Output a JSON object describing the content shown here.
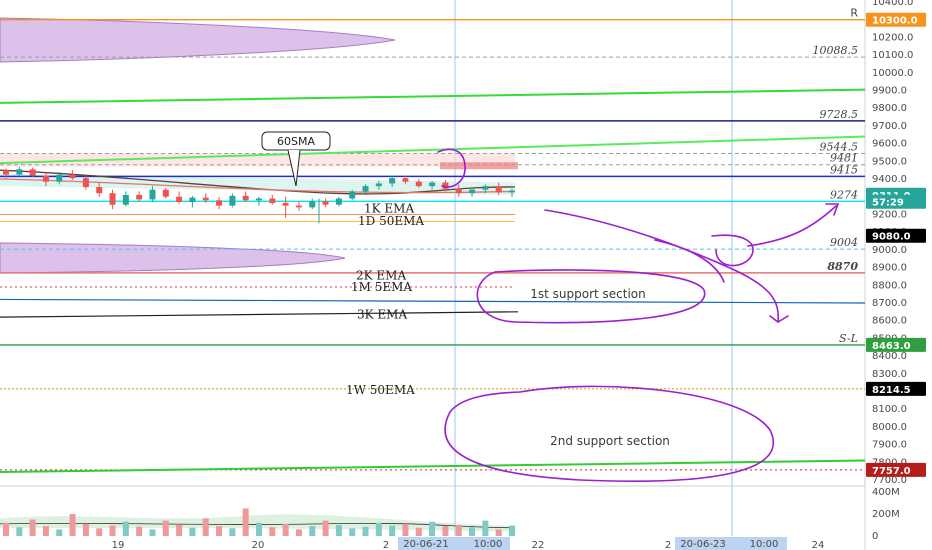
{
  "chart_data": {
    "type": "candlestick",
    "y_axis": {
      "ticks": [
        "10400.0",
        "10300.0",
        "10200.0",
        "10100.0",
        "10000.0",
        "9900.0",
        "9800.0",
        "9700.0",
        "9600.0",
        "9500.0",
        "9400.0",
        "9300.0",
        "9200.0",
        "9100.0",
        "9000.0",
        "8900.0",
        "8800.0",
        "8700.0",
        "8600.0",
        "8500.0",
        "8400.0",
        "8300.0",
        "8200.0",
        "8100.0",
        "8000.0",
        "7900.0",
        "7800.0",
        "7700.0"
      ],
      "tick_values": [
        10400,
        10300,
        10200,
        10100,
        10000,
        9900,
        9800,
        9700,
        9600,
        9500,
        9400,
        9300,
        9200,
        9100,
        9000,
        8900,
        8800,
        8700,
        8600,
        8500,
        8400,
        8300,
        8200,
        8100,
        8000,
        7900,
        7800,
        7700
      ],
      "range": [
        7680,
        10430
      ],
      "position": "right"
    },
    "x_axis": {
      "ticks": [
        "19",
        "20",
        "2",
        "22",
        "2",
        "24"
      ],
      "date_labels": [
        "20-06-21",
        "10:00",
        "20-06-23",
        "10:00"
      ]
    },
    "price_tags": [
      {
        "text": "10300.0",
        "value": 10300,
        "color": "#f7931a"
      },
      {
        "text": "9311.0",
        "value": 9311,
        "color": "#26a69a"
      },
      {
        "text": "57:29",
        "value": 9272,
        "color": "#26a69a"
      },
      {
        "text": "9080.0",
        "value": 9080,
        "color": "#000000"
      },
      {
        "text": "8463.0",
        "value": 8463,
        "color": "#2e9e3e"
      },
      {
        "text": "8214.5",
        "value": 8214.5,
        "color": "#000000"
      },
      {
        "text": "7757.0",
        "value": 7757,
        "color": "#b71c1c"
      }
    ],
    "horizontal_levels": [
      {
        "label": "R",
        "value": 10300,
        "color": "#f7931a",
        "style": "solid"
      },
      {
        "label": "10088.5",
        "value": 10088.5,
        "color": "#9e9e9e",
        "style": "dashed"
      },
      {
        "label": "9728.5",
        "value": 9728.5,
        "color": "#1a237e",
        "style": "solid"
      },
      {
        "label": "9544.5",
        "value": 9544.5,
        "color": "#9e9e9e",
        "style": "dashed"
      },
      {
        "label": "9481",
        "value": 9481,
        "color": "#9e9e9e",
        "style": "dashed"
      },
      {
        "label": "9415",
        "value": 9415,
        "color": "#1e2bd8",
        "style": "solid"
      },
      {
        "label": "9274",
        "value": 9274,
        "color": "#00e5ff",
        "style": "solid"
      },
      {
        "label": "9004",
        "value": 9004,
        "color": "#4fc3f7",
        "style": "dashed"
      },
      {
        "label": "8870",
        "value": 8870,
        "color": "#e57373",
        "style": "solid"
      },
      {
        "label": "S-L",
        "value": 8463,
        "color": "#2e9e3e",
        "style": "solid"
      }
    ],
    "trend_lines": [
      {
        "color": "#33dd33",
        "start": 9830,
        "end": 9905
      },
      {
        "color": "#5bea5b",
        "start": 9490,
        "end": 9640
      },
      {
        "color": "#33cc33",
        "start": 7745,
        "end": 7810
      }
    ],
    "annotations": {
      "callout": "60SMA",
      "ema_labels": [
        {
          "text": "1K EMA",
          "value": 9240
        },
        {
          "text": "1D 50EMA",
          "value": 9170
        },
        {
          "text": "2K EMA",
          "value": 8862
        },
        {
          "text": "1M 5EMA",
          "value": 8797
        },
        {
          "text": "3K EMA",
          "value": 8640
        },
        {
          "text": "1W 50EMA",
          "value": 8214.5
        }
      ],
      "support_1": "1st support section",
      "support_2": "2nd support section"
    },
    "volume_axis": {
      "ticks": [
        "400M",
        "200M",
        "0"
      ],
      "tick_values": [
        400,
        200,
        0
      ]
    },
    "candles": [
      [
        9450,
        9460,
        9400,
        9425
      ],
      [
        9425,
        9470,
        9415,
        9455
      ],
      [
        9455,
        9465,
        9410,
        9420
      ],
      [
        9420,
        9430,
        9360,
        9385
      ],
      [
        9385,
        9440,
        9370,
        9425
      ],
      [
        9425,
        9450,
        9395,
        9405
      ],
      [
        9405,
        9420,
        9340,
        9355
      ],
      [
        9355,
        9380,
        9300,
        9320
      ],
      [
        9320,
        9340,
        9230,
        9255
      ],
      [
        9255,
        9330,
        9245,
        9310
      ],
      [
        9310,
        9330,
        9270,
        9285
      ],
      [
        9285,
        9360,
        9270,
        9340
      ],
      [
        9340,
        9350,
        9290,
        9300
      ],
      [
        9300,
        9330,
        9260,
        9270
      ],
      [
        9270,
        9305,
        9240,
        9295
      ],
      [
        9295,
        9320,
        9265,
        9280
      ],
      [
        9280,
        9300,
        9230,
        9250
      ],
      [
        9250,
        9320,
        9240,
        9305
      ],
      [
        9305,
        9330,
        9270,
        9280
      ],
      [
        9280,
        9300,
        9250,
        9290
      ],
      [
        9290,
        9310,
        9255,
        9265
      ],
      [
        9265,
        9300,
        9180,
        9250
      ],
      [
        9250,
        9275,
        9220,
        9240
      ],
      [
        9240,
        9290,
        9230,
        9275
      ],
      [
        9275,
        9290,
        9240,
        9255
      ],
      [
        9255,
        9300,
        9245,
        9290
      ],
      [
        9290,
        9340,
        9280,
        9330
      ],
      [
        9330,
        9370,
        9310,
        9360
      ],
      [
        9360,
        9390,
        9340,
        9375
      ],
      [
        9375,
        9420,
        9355,
        9405
      ],
      [
        9405,
        9420,
        9370,
        9385
      ],
      [
        9385,
        9400,
        9350,
        9360
      ],
      [
        9360,
        9390,
        9340,
        9380
      ],
      [
        9380,
        9395,
        9330,
        9345
      ],
      [
        9345,
        9370,
        9300,
        9320
      ],
      [
        9320,
        9350,
        9300,
        9340
      ],
      [
        9340,
        9370,
        9320,
        9360
      ],
      [
        9360,
        9380,
        9310,
        9325
      ],
      [
        9325,
        9345,
        9300,
        9335
      ]
    ],
    "volumes": [
      120,
      80,
      150,
      90,
      60,
      200,
      110,
      70,
      95,
      130,
      85,
      60,
      140,
      100,
      75,
      160,
      90,
      70,
      250,
      120,
      80,
      110,
      60,
      90,
      140,
      100,
      70,
      85,
      120,
      95,
      110,
      75,
      130,
      90,
      100,
      80,
      140,
      60,
      95
    ]
  }
}
